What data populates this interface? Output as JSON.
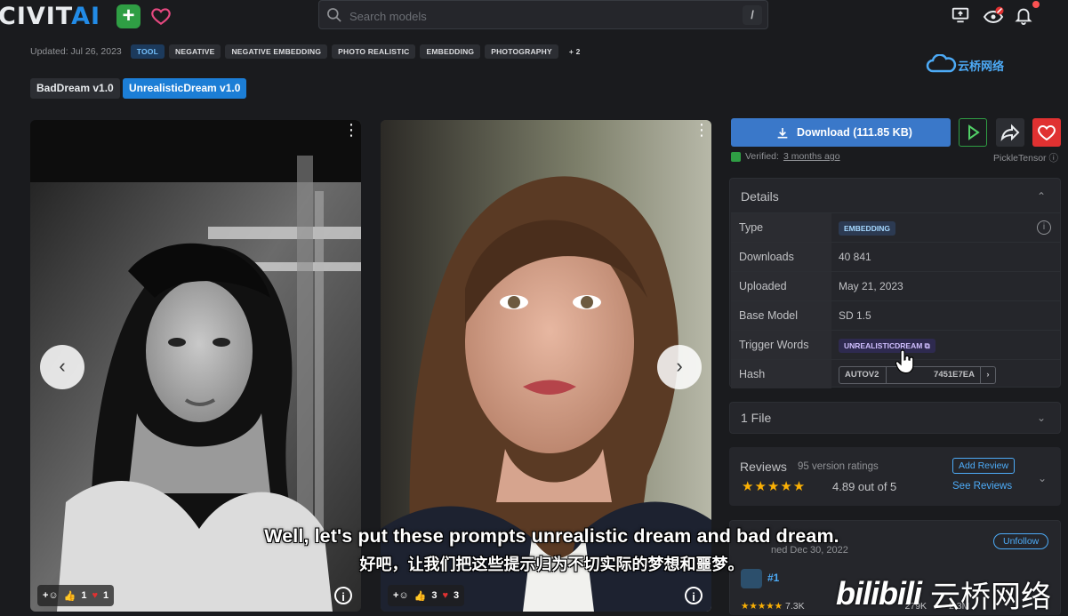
{
  "header": {
    "logo_text": "CIVIT",
    "logo_accent": "AI",
    "add_label": "+",
    "search_placeholder": "Search models",
    "search_shortcut": "/"
  },
  "meta": {
    "updated": "Updated: Jul 26, 2023",
    "tags": [
      "TOOL",
      "NEGATIVE",
      "NEGATIVE EMBEDDING",
      "PHOTO REALISTIC",
      "EMBEDDING",
      "PHOTOGRAPHY",
      "+ 2"
    ]
  },
  "watermark_top": "云桥网络",
  "versions": [
    "BadDream v1.0",
    "UnrealisticDream v1.0"
  ],
  "gallery": [
    {
      "thumbs": "1",
      "hearts": "1"
    },
    {
      "thumbs": "3",
      "hearts": "3"
    }
  ],
  "download": {
    "label": "Download (111.85 KB)",
    "verified_prefix": "Verified:",
    "verified_when": "3 months ago",
    "scanner": "PickleTensor"
  },
  "details": {
    "title": "Details",
    "rows": [
      {
        "key": "Type",
        "value": "EMBEDDING"
      },
      {
        "key": "Downloads",
        "value": "40 841"
      },
      {
        "key": "Uploaded",
        "value": "May 21, 2023"
      },
      {
        "key": "Base Model",
        "value": "SD 1.5"
      },
      {
        "key": "Trigger Words",
        "value": "UNREALISTICDREAM"
      },
      {
        "key": "Hash",
        "value": "7451E7EA",
        "hash_type": "AUTOV2"
      }
    ]
  },
  "files": {
    "title": "1 File"
  },
  "reviews": {
    "title": "Reviews",
    "count": "95 version ratings",
    "score": "4.89 out of 5",
    "add_label": "Add Review",
    "see_label": "See Reviews",
    "rating": 4.89
  },
  "creator": {
    "joined": "ned Dec 30, 2022",
    "unfollow": "Unfollow",
    "rank": "#1",
    "stats_rating_count": "7.3K",
    "stats_followers": "279K",
    "stats_downloads": "2.3M"
  },
  "subtitles": {
    "en": "Well, let's put these prompts unrealistic dream and bad dream.",
    "zh": "好吧，让我们把这些提示归为不切实际的梦想和噩梦。"
  },
  "watermark_bottom": {
    "brand": "bilibili",
    "name": "云桥网络"
  },
  "colors": {
    "accent": "#228be6",
    "download": "#3a78c9",
    "heart": "#e03131",
    "play": "#2f9e44"
  }
}
